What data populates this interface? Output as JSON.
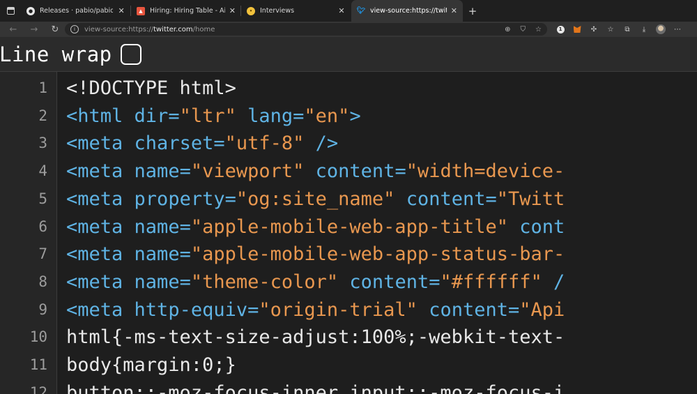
{
  "tabs": [
    {
      "title": "Releases · pabio/pabio",
      "icon": "github-icon",
      "active": false
    },
    {
      "title": "Hiring: Hiring Table - Airtable",
      "icon": "airtable-icon",
      "active": false
    },
    {
      "title": "Interviews",
      "icon": "emoji-icon",
      "active": false
    },
    {
      "title": "view-source:https://twitter.com/home",
      "icon": "twitter-icon",
      "active": true
    }
  ],
  "address": {
    "prefix": "view-source:https://",
    "host": "twitter.com",
    "path": "/home"
  },
  "line_wrap": {
    "label": "Line wrap",
    "checked": false
  },
  "lines": [
    {
      "n": "1",
      "parts": [
        {
          "t": "plain",
          "s": "<!DOCTYPE html>"
        }
      ]
    },
    {
      "n": "2",
      "parts": [
        {
          "t": "tag",
          "s": "<html"
        },
        {
          "t": "plain",
          "s": " "
        },
        {
          "t": "attr",
          "s": "dir="
        },
        {
          "t": "val",
          "s": "\"ltr\""
        },
        {
          "t": "plain",
          "s": " "
        },
        {
          "t": "attr",
          "s": "lang="
        },
        {
          "t": "val",
          "s": "\"en\""
        },
        {
          "t": "tag",
          "s": ">"
        }
      ]
    },
    {
      "n": "3",
      "parts": [
        {
          "t": "tag",
          "s": "<meta"
        },
        {
          "t": "plain",
          "s": " "
        },
        {
          "t": "attr",
          "s": "charset="
        },
        {
          "t": "val",
          "s": "\"utf-8\""
        },
        {
          "t": "plain",
          "s": " "
        },
        {
          "t": "tag",
          "s": "/>"
        }
      ]
    },
    {
      "n": "4",
      "parts": [
        {
          "t": "tag",
          "s": "<meta"
        },
        {
          "t": "plain",
          "s": " "
        },
        {
          "t": "attr",
          "s": "name="
        },
        {
          "t": "val",
          "s": "\"viewport\""
        },
        {
          "t": "plain",
          "s": " "
        },
        {
          "t": "attr",
          "s": "content="
        },
        {
          "t": "val",
          "s": "\"width=device-"
        }
      ]
    },
    {
      "n": "5",
      "parts": [
        {
          "t": "tag",
          "s": "<meta"
        },
        {
          "t": "plain",
          "s": " "
        },
        {
          "t": "attr",
          "s": "property="
        },
        {
          "t": "val",
          "s": "\"og:site_name\""
        },
        {
          "t": "plain",
          "s": " "
        },
        {
          "t": "attr",
          "s": "content="
        },
        {
          "t": "val",
          "s": "\"Twitt"
        }
      ]
    },
    {
      "n": "6",
      "parts": [
        {
          "t": "tag",
          "s": "<meta"
        },
        {
          "t": "plain",
          "s": " "
        },
        {
          "t": "attr",
          "s": "name="
        },
        {
          "t": "val",
          "s": "\"apple-mobile-web-app-title\""
        },
        {
          "t": "plain",
          "s": " "
        },
        {
          "t": "attr",
          "s": "cont"
        }
      ]
    },
    {
      "n": "7",
      "parts": [
        {
          "t": "tag",
          "s": "<meta"
        },
        {
          "t": "plain",
          "s": " "
        },
        {
          "t": "attr",
          "s": "name="
        },
        {
          "t": "val",
          "s": "\"apple-mobile-web-app-status-bar-"
        }
      ]
    },
    {
      "n": "8",
      "parts": [
        {
          "t": "tag",
          "s": "<meta"
        },
        {
          "t": "plain",
          "s": " "
        },
        {
          "t": "attr",
          "s": "name="
        },
        {
          "t": "val",
          "s": "\"theme-color\""
        },
        {
          "t": "plain",
          "s": " "
        },
        {
          "t": "attr",
          "s": "content="
        },
        {
          "t": "val",
          "s": "\"#ffffff\""
        },
        {
          "t": "plain",
          "s": " "
        },
        {
          "t": "tag",
          "s": "/"
        }
      ]
    },
    {
      "n": "9",
      "parts": [
        {
          "t": "tag",
          "s": "<meta"
        },
        {
          "t": "plain",
          "s": " "
        },
        {
          "t": "attr",
          "s": "http-equiv="
        },
        {
          "t": "val",
          "s": "\"origin-trial\""
        },
        {
          "t": "plain",
          "s": " "
        },
        {
          "t": "attr",
          "s": "content="
        },
        {
          "t": "val",
          "s": "\"Api"
        }
      ]
    },
    {
      "n": "10",
      "parts": [
        {
          "t": "plain",
          "s": "html{-ms-text-size-adjust:100%;-webkit-text-"
        }
      ]
    },
    {
      "n": "11",
      "parts": [
        {
          "t": "plain",
          "s": "body{margin:0;}"
        }
      ]
    },
    {
      "n": "12",
      "parts": [
        {
          "t": "plain",
          "s": "button::-moz-focus-inner,input::-moz-focus-i"
        }
      ]
    }
  ],
  "colors": {
    "tag": "#5fb3e4",
    "value": "#e8974f",
    "text": "#e8e8e8",
    "background": "#1e1e1e"
  }
}
